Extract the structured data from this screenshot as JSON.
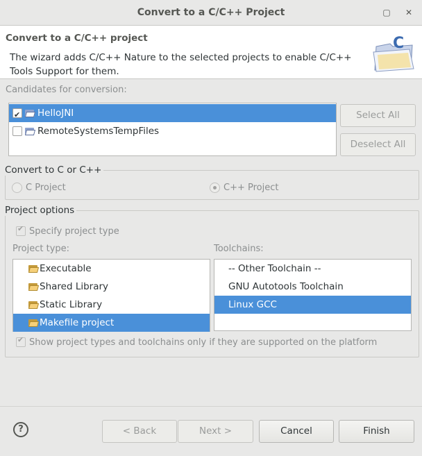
{
  "window": {
    "title": "Convert to a C/C++ Project",
    "maximize_glyph": "▢",
    "close_glyph": "✕"
  },
  "header": {
    "title": "Convert to a C/C++ project",
    "description": "The wizard adds C/C++ Nature to the selected projects to enable C/C++ Tools Support for them."
  },
  "candidates": {
    "label": "Candidates for conversion:",
    "items": [
      {
        "label": "HelloJNI",
        "checked": true,
        "selected": true
      },
      {
        "label": "RemoteSystemsTempFiles",
        "checked": false,
        "selected": false
      }
    ],
    "select_all": "Select All",
    "deselect_all": "Deselect All"
  },
  "convert": {
    "title": "Convert to C or C++",
    "c_project": "C Project",
    "cpp_project": "C++ Project",
    "selected": "C++ Project"
  },
  "options": {
    "title": "Project options",
    "specify_type": "Specify project type",
    "project_type_label": "Project type:",
    "toolchains_label": "Toolchains:",
    "project_types": [
      {
        "label": "Executable",
        "selected": false
      },
      {
        "label": "Shared Library",
        "selected": false
      },
      {
        "label": "Static Library",
        "selected": false
      },
      {
        "label": "Makefile project",
        "selected": true
      }
    ],
    "toolchains": [
      {
        "label": "-- Other Toolchain --",
        "selected": false
      },
      {
        "label": "GNU Autotools Toolchain",
        "selected": false
      },
      {
        "label": "Linux GCC",
        "selected": true
      }
    ],
    "show_supported": "Show project types and toolchains only if they are supported on the platform"
  },
  "footer": {
    "help": "?",
    "back": "< Back",
    "next": "Next >",
    "cancel": "Cancel",
    "finish": "Finish"
  },
  "colors": {
    "selection": "#4a90d9",
    "window_bg": "#e8e8e7"
  }
}
